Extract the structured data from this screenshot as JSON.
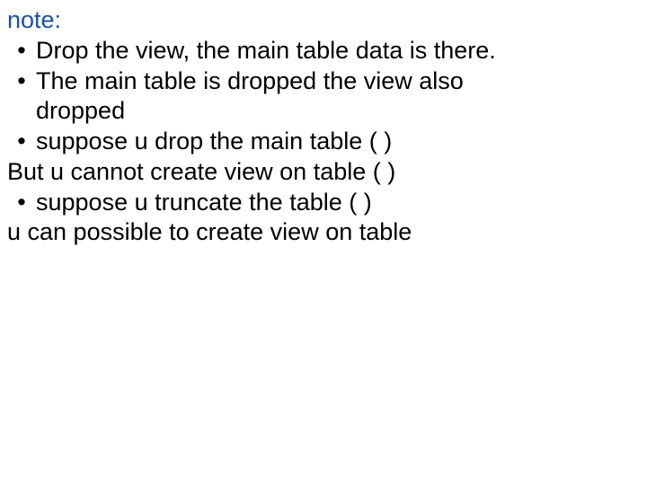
{
  "heading": "note:",
  "bullet": "•",
  "items": {
    "b1": "Drop the view, the main table data is there.",
    "b2": "The main table is dropped the view also",
    "b2_cont": "dropped",
    "b3": "suppose u drop the main table (     )",
    "plain1": "But u cannot create view on table (      )",
    "b4": "suppose u truncate the table (        )",
    "plain2": "u can possible to create view on table"
  }
}
